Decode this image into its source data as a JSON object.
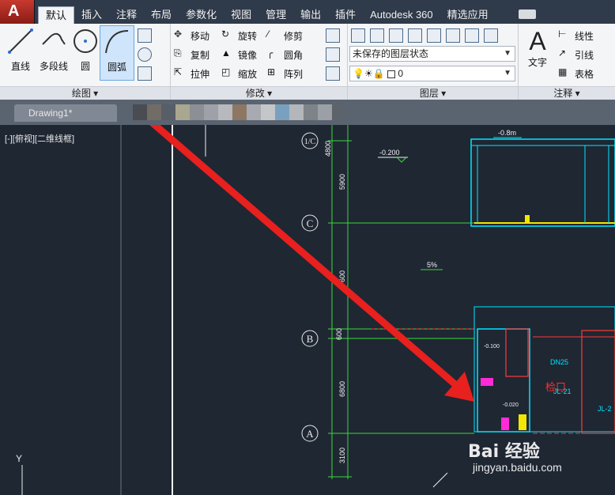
{
  "menu": [
    "默认",
    "插入",
    "注释",
    "布局",
    "参数化",
    "视图",
    "管理",
    "输出",
    "插件",
    "Autodesk 360",
    "精选应用"
  ],
  "ribbon": {
    "draw_panel": {
      "title": "绘图 ▾",
      "line": "直线",
      "polyline": "多段线",
      "circle": "圆",
      "arc": "圆弧"
    },
    "modify_panel": {
      "title": "修改 ▾",
      "move": "移动",
      "rotate": "旋转",
      "trim": "修剪",
      "copy": "复制",
      "mirror": "镜像",
      "fillet": "圆角",
      "stretch": "拉伸",
      "scale": "缩放",
      "array": "阵列"
    },
    "layer_panel": {
      "title": "图层 ▾",
      "state": "未保存的图层状态",
      "current_layer": "0"
    },
    "annotation_panel": {
      "title": "注释 ▾",
      "text": "文字",
      "linear": "线性",
      "leader": "引线",
      "table": "表格"
    }
  },
  "doc_tab": "Drawing1*",
  "viewport_label": "[-][俯视][二维线框]",
  "axis_y_label": "Y",
  "drawing": {
    "grid_labels": [
      "1/C",
      "C",
      "B",
      "A"
    ],
    "dims": [
      "4800",
      "5900",
      "7600",
      "600",
      "6800",
      "3100"
    ],
    "elev_1": "-0.200",
    "elev_2": "-0.8m",
    "slope": "5%",
    "pipe_label": "DN25",
    "jl_1": "JL-21",
    "jl_2": "JL-2",
    "red_note": "检口",
    "small_1": "-0.100",
    "small_2": "-0.020"
  },
  "watermark": {
    "logo": "Bai 经验",
    "url": "jingyan.baidu.com"
  },
  "colors": {
    "canvas": "#1f2733",
    "arrow": "#e8201e",
    "cyan": "#00e5ff",
    "green": "#39d93a",
    "yellow": "#f2e600"
  }
}
